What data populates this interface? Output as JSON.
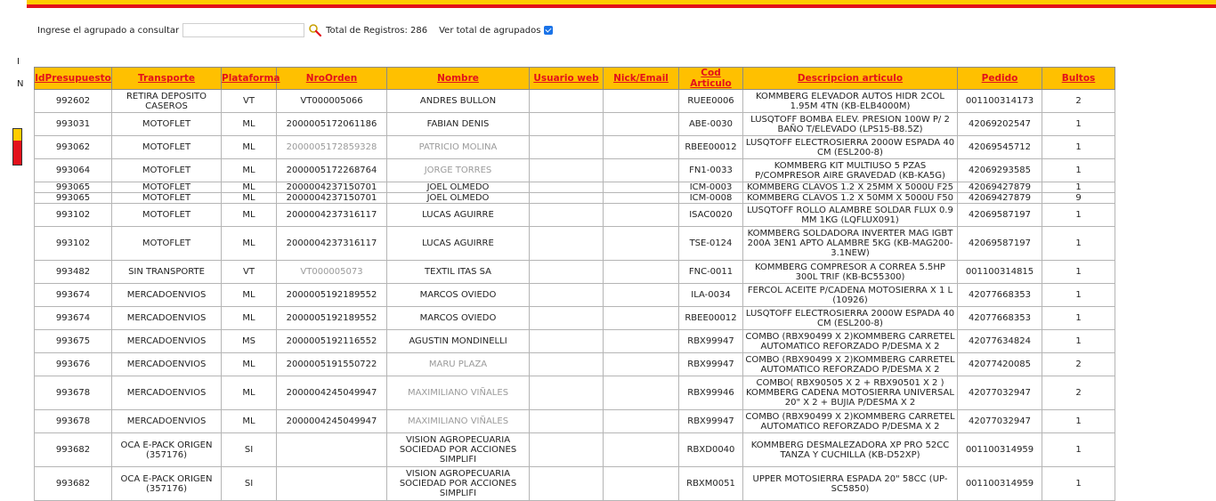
{
  "search": {
    "label": "Ingrese el agrupado a consultar",
    "value": "",
    "total_label": "Total de Registros: 286",
    "ver_total_label": "Ver total de agrupados",
    "ver_total_checked": true
  },
  "left_text": {
    "i": "I",
    "n": "N"
  },
  "colors": {
    "header_bg": "#ffc000",
    "header_text": "#e3111b",
    "bar_yellow": "#ffcc00",
    "bar_red": "#e3111b"
  },
  "table": {
    "columns": [
      "IdPresupuesto",
      "Transporte",
      "Plataforma",
      "NroOrden",
      "Nombre",
      "Usuario web",
      "Nick/Email",
      "Cod Articulo",
      "Descripcion articulo",
      "Pedido",
      "Bultos"
    ],
    "rows": [
      [
        "992602",
        "RETIRA DEPOSITO CASEROS",
        "VT",
        "VT000005066",
        "ANDRES BULLON",
        "",
        "",
        "RUEE0006",
        "KOMMBERG ELEVADOR AUTOS HIDR 2COL 1.95M 4TN (KB-ELB4000M)",
        "001100314173",
        "2"
      ],
      [
        "993031",
        "MOTOFLET",
        "ML",
        "2000005172061186",
        "FABIAN DENIS",
        "",
        "",
        "ABE-0030",
        "LUSQTOFF BOMBA ELEV. PRESION 100W P/ 2 BAÑO T/ELEVADO (LPS15-B8.5Z)",
        "42069202547",
        "1"
      ],
      [
        "993062",
        "MOTOFLET",
        "ML",
        "2000005172859328",
        "PATRICIO MOLINA",
        "",
        "",
        "RBEE00012",
        "LUSQTOFF ELECTROSIERRA 2000W ESPADA 40 CM (ESL200-8)",
        "42069545712",
        "1"
      ],
      [
        "993064",
        "MOTOFLET",
        "ML",
        "2000005172268764",
        "JORGE TORRES",
        "",
        "",
        "FN1-0033",
        "KOMMBERG KIT MULTIUSO 5 PZAS P/COMPRESOR AIRE GRAVEDAD (KB-KA5G)",
        "42069293585",
        "1"
      ],
      [
        "993065",
        "MOTOFLET",
        "ML",
        "2000004237150701",
        "JOEL OLMEDO",
        "",
        "",
        "ICM-0003",
        "KOMMBERG CLAVOS 1.2 X 25MM X 5000U F25",
        "42069427879",
        "1"
      ],
      [
        "993065",
        "MOTOFLET",
        "ML",
        "2000004237150701",
        "JOEL OLMEDO",
        "",
        "",
        "ICM-0008",
        "KOMMBERG CLAVOS 1.2 X 50MM X 5000U F50",
        "42069427879",
        "9"
      ],
      [
        "993102",
        "MOTOFLET",
        "ML",
        "2000004237316117",
        "LUCAS AGUIRRE",
        "",
        "",
        "ISAC0020",
        "LUSQTOFF ROLLO ALAMBRE SOLDAR FLUX 0.9 MM 1KG (LQFLUX091)",
        "42069587197",
        "1"
      ],
      [
        "993102",
        "MOTOFLET",
        "ML",
        "2000004237316117",
        "LUCAS AGUIRRE",
        "",
        "",
        "TSE-0124",
        "KOMMBERG SOLDADORA INVERTER MAG IGBT 200A 3EN1 APTO ALAMBRE 5KG (KB-MAG200-3.1NEW)",
        "42069587197",
        "1"
      ],
      [
        "993482",
        "SIN TRANSPORTE",
        "VT",
        "VT000005073",
        "TEXTIL ITAS SA",
        "",
        "",
        "FNC-0011",
        "KOMMBERG COMPRESOR A CORREA 5.5HP 300L TRIF (KB-BC55300)",
        "001100314815",
        "1"
      ],
      [
        "993674",
        "MERCADOENVIOS",
        "ML",
        "2000005192189552",
        "MARCOS OVIEDO",
        "",
        "",
        "ILA-0034",
        "FERCOL ACEITE P/CADENA MOTOSIERRA X 1 L (10926)",
        "42077668353",
        "1"
      ],
      [
        "993674",
        "MERCADOENVIOS",
        "ML",
        "2000005192189552",
        "MARCOS OVIEDO",
        "",
        "",
        "RBEE00012",
        "LUSQTOFF ELECTROSIERRA 2000W ESPADA 40 CM (ESL200-8)",
        "42077668353",
        "1"
      ],
      [
        "993675",
        "MERCADOENVIOS",
        "MS",
        "2000005192116552",
        "AGUSTIN MONDINELLI",
        "",
        "",
        "RBX99947",
        "COMBO (RBX90499 X 2)KOMMBERG CARRETEL AUTOMATICO REFORZADO P/DESMA X 2",
        "42077634824",
        "1"
      ],
      [
        "993676",
        "MERCADOENVIOS",
        "ML",
        "2000005191550722",
        "MARU PLAZA",
        "",
        "",
        "RBX99947",
        "COMBO (RBX90499 X 2)KOMMBERG CARRETEL AUTOMATICO REFORZADO P/DESMA X 2",
        "42077420085",
        "2"
      ],
      [
        "993678",
        "MERCADOENVIOS",
        "ML",
        "2000004245049947",
        "MAXIMILIANO VIÑALES",
        "",
        "",
        "RBX99946",
        "COMBO( RBX90505 X 2 + RBX90501 X 2 ) KOMMBERG CADENA MOTOSIERRA UNIVERSAL 20\" X 2 + BUJIA P/DESMA X 2",
        "42077032947",
        "2"
      ],
      [
        "993678",
        "MERCADOENVIOS",
        "ML",
        "2000004245049947",
        "MAXIMILIANO VIÑALES",
        "",
        "",
        "RBX99947",
        "COMBO (RBX90499 X 2)KOMMBERG CARRETEL AUTOMATICO REFORZADO P/DESMA X 2",
        "42077032947",
        "1"
      ],
      [
        "993682",
        "OCA E-PACK ORIGEN (357176)",
        "SI",
        "",
        "VISION AGROPECUARIA SOCIEDAD POR ACCIONES SIMPLIFI",
        "",
        "",
        "RBXD0040",
        "KOMMBERG DESMALEZADORA XP PRO 52CC TANZA Y CUCHILLA (KB-D52XP)",
        "001100314959",
        "1"
      ],
      [
        "993682",
        "OCA E-PACK ORIGEN (357176)",
        "SI",
        "",
        "VISION AGROPECUARIA SOCIEDAD POR ACCIONES SIMPLIFI",
        "",
        "",
        "RBXM0051",
        "UPPER MOTOSIERRA ESPADA 20\" 58CC (UP-SC5850)",
        "001100314959",
        "1"
      ]
    ]
  }
}
